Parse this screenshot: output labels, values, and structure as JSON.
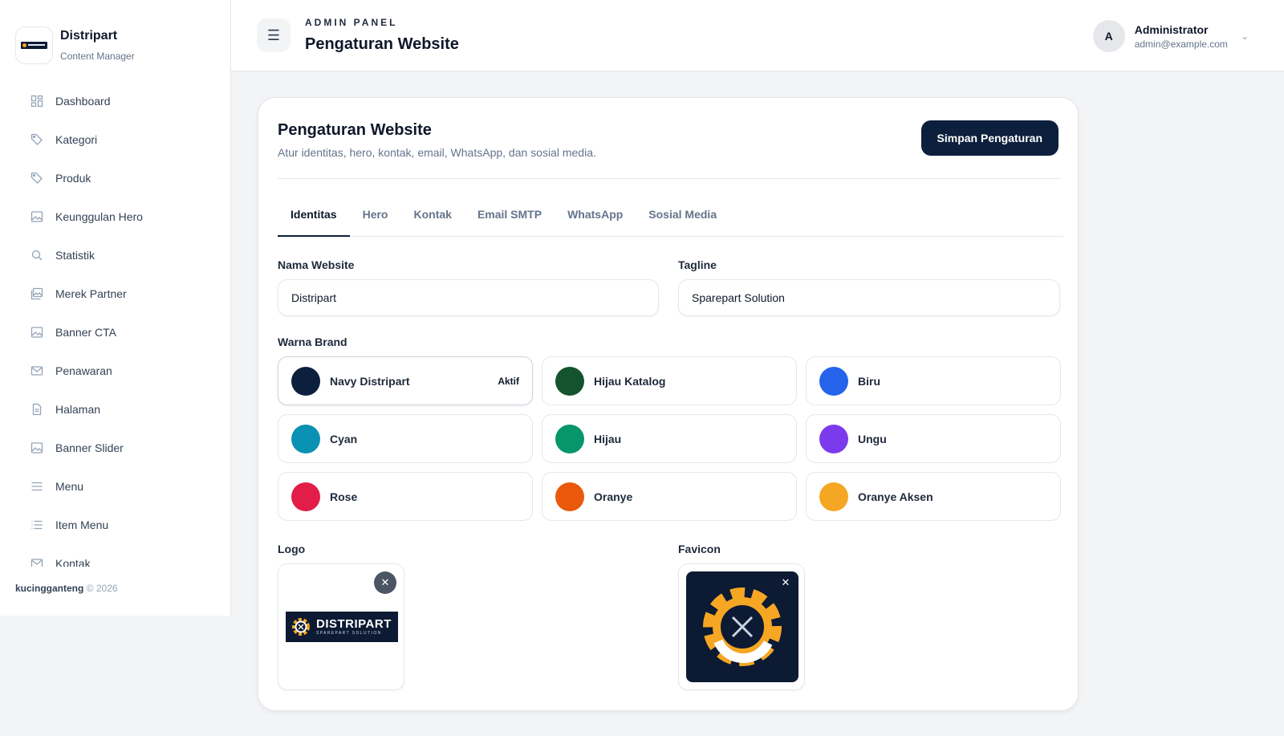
{
  "sidebar": {
    "brand": {
      "name": "Distripart",
      "subtitle": "Content Manager"
    },
    "items": [
      {
        "label": "Dashboard",
        "icon": "dashboard-icon"
      },
      {
        "label": "Kategori",
        "icon": "tag-icon"
      },
      {
        "label": "Produk",
        "icon": "tag-icon"
      },
      {
        "label": "Keunggulan Hero",
        "icon": "image-icon"
      },
      {
        "label": "Statistik",
        "icon": "search-icon"
      },
      {
        "label": "Merek Partner",
        "icon": "gallery-icon"
      },
      {
        "label": "Banner CTA",
        "icon": "image-icon"
      },
      {
        "label": "Penawaran",
        "icon": "mail-icon"
      },
      {
        "label": "Halaman",
        "icon": "document-icon"
      },
      {
        "label": "Banner Slider",
        "icon": "image-icon"
      },
      {
        "label": "Menu",
        "icon": "menu-icon"
      },
      {
        "label": "Item Menu",
        "icon": "list-icon"
      },
      {
        "label": "Kontak",
        "icon": "mail-icon"
      }
    ],
    "footer": {
      "author": "kucingganteng",
      "copyright": "© 2026"
    }
  },
  "header": {
    "kicker": "ADMIN PANEL",
    "title": "Pengaturan Website",
    "user": {
      "initial": "A",
      "name": "Administrator",
      "email": "admin@example.com"
    }
  },
  "card": {
    "title": "Pengaturan Website",
    "subtitle": "Atur identitas, hero, kontak, email, WhatsApp, dan sosial media.",
    "save_label": "Simpan Pengaturan",
    "tabs": [
      "Identitas",
      "Hero",
      "Kontak",
      "Email SMTP",
      "WhatsApp",
      "Sosial Media"
    ],
    "active_tab": "Identitas"
  },
  "form": {
    "site_name": {
      "label": "Nama Website",
      "value": "Distripart"
    },
    "tagline": {
      "label": "Tagline",
      "value": "Sparepart Solution"
    },
    "brand_color_label": "Warna Brand",
    "active_label": "Aktif",
    "colors": [
      {
        "name": "Navy Distripart",
        "hex": "#0c1f3c",
        "active": true
      },
      {
        "name": "Hijau Katalog",
        "hex": "#14532d",
        "active": false
      },
      {
        "name": "Biru",
        "hex": "#2563eb",
        "active": false
      },
      {
        "name": "Cyan",
        "hex": "#0891b2",
        "active": false
      },
      {
        "name": "Hijau",
        "hex": "#059669",
        "active": false
      },
      {
        "name": "Ungu",
        "hex": "#7c3aed",
        "active": false
      },
      {
        "name": "Rose",
        "hex": "#e11d48",
        "active": false
      },
      {
        "name": "Oranye",
        "hex": "#ea580c",
        "active": false
      },
      {
        "name": "Oranye Aksen",
        "hex": "#f5a623",
        "active": false
      }
    ],
    "logo_label": "Logo",
    "logo_text": {
      "word": "DISTRIPART",
      "tagline": "SPAREPART SOLUTION"
    },
    "favicon_label": "Favicon",
    "remove_symbol": "✕"
  }
}
